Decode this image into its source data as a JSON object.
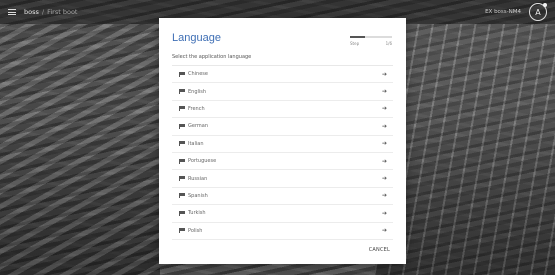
{
  "header": {
    "brand": "boss",
    "separator": "/",
    "breadcrumb": "First boot",
    "user_label": "EX boss-NM4",
    "avatar_letter": "A"
  },
  "dialog": {
    "title": "Language",
    "subtitle": "Select the application language",
    "progress": {
      "start_label": "Step",
      "end_label": "1/6",
      "fraction": 0.35
    },
    "languages": [
      {
        "label": "Chinese",
        "icon": "flag-icon",
        "action_icon": "arrow-right-icon"
      },
      {
        "label": "English",
        "icon": "flag-icon",
        "action_icon": "arrow-right-icon"
      },
      {
        "label": "French",
        "icon": "flag-icon",
        "action_icon": "arrow-right-icon"
      },
      {
        "label": "German",
        "icon": "flag-icon",
        "action_icon": "arrow-right-icon"
      },
      {
        "label": "Italian",
        "icon": "flag-icon",
        "action_icon": "arrow-right-icon"
      },
      {
        "label": "Portuguese",
        "icon": "flag-icon",
        "action_icon": "arrow-right-icon"
      },
      {
        "label": "Russian",
        "icon": "flag-icon",
        "action_icon": "arrow-right-icon"
      },
      {
        "label": "Spanish",
        "icon": "flag-icon",
        "action_icon": "arrow-right-icon"
      },
      {
        "label": "Turkish",
        "icon": "flag-icon",
        "action_icon": "arrow-right-icon"
      },
      {
        "label": "Polish",
        "icon": "flag-icon",
        "action_icon": "arrow-right-icon"
      }
    ],
    "cancel_label": "CANCEL"
  },
  "colors": {
    "title": "#3f6fb5",
    "progress_fill": "#555555"
  }
}
